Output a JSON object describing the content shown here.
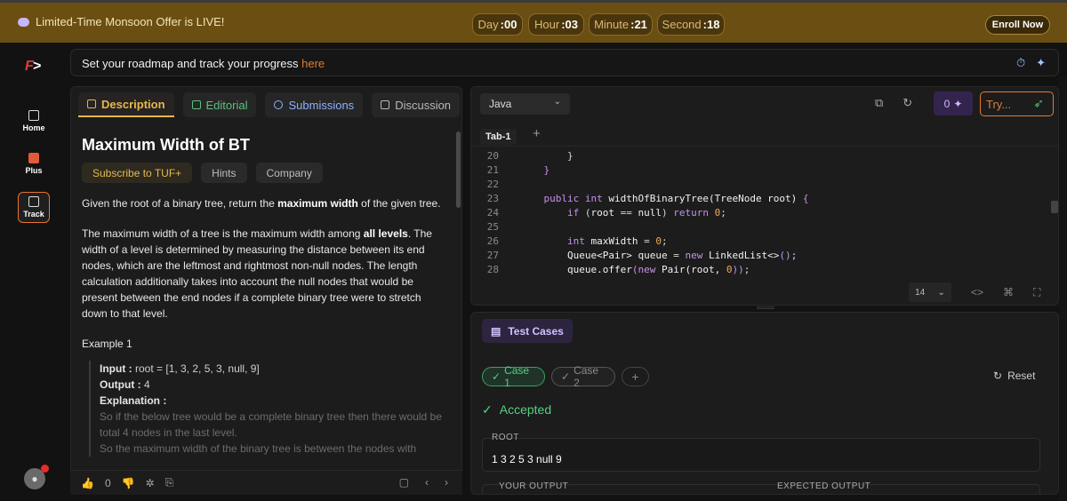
{
  "banner": {
    "offer": "Limited-Time Monsoon Offer is LIVE!",
    "timers": [
      {
        "label": "Day",
        "value": ":00"
      },
      {
        "label": "Hour",
        "value": ":03"
      },
      {
        "label": "Minute",
        "value": ":21"
      },
      {
        "label": "Second",
        "value": ":18"
      }
    ],
    "enroll": "Enroll Now"
  },
  "sidebar": {
    "logo": "F",
    "items": [
      {
        "label": "Home"
      },
      {
        "label": "Plus"
      },
      {
        "label": "Track"
      }
    ]
  },
  "roadmap": {
    "text": "Set your roadmap and track your progress",
    "link": "here"
  },
  "description": {
    "tabs": [
      {
        "label": "Description"
      },
      {
        "label": "Editorial"
      },
      {
        "label": "Submissions"
      },
      {
        "label": "Discussion"
      }
    ],
    "title": "Maximum Width of BT",
    "chips": [
      "Subscribe to TUF+",
      "Hints",
      "Company"
    ],
    "p1_a": "Given the root of a binary tree, return the",
    "p1_b": "maximum width",
    "p1_c": "of the given tree.",
    "p2_a": "The maximum width of a tree is the maximum width among",
    "p2_b": "all levels",
    "p2_c": ". The width of a level is determined by measuring the distance between its end nodes, which are the leftmost and rightmost non-null nodes. The length calculation additionally takes into account the null nodes that would be present between the end nodes if a complete binary tree were to stretch down to that level.",
    "example_title": "Example 1",
    "input_label": "Input :",
    "input_value": "root = [1, 3, 2, 5, 3, null, 9]",
    "output_label": "Output :",
    "output_value": "4",
    "explanation_label": "Explanation :",
    "explanation_1": "So if the below tree would be a complete binary tree then there would be total 4 nodes in the last level.",
    "explanation_2": "So the maximum width of the binary tree is between the nodes with",
    "likes": "0"
  },
  "editor": {
    "language": "Java",
    "ai_count": "0",
    "try_label": "Try...",
    "tab": "Tab-1",
    "font_size": "14",
    "lines": [
      20,
      21,
      22,
      23,
      24,
      25,
      26,
      27,
      28
    ]
  },
  "tests": {
    "title": "Test Cases",
    "cases": [
      "Case 1",
      "Case 2"
    ],
    "reset": "Reset",
    "status": "Accepted",
    "root_label": "ROOT",
    "root_value": "1 3 2 5 3 null 9",
    "your_output": "YOUR OUTPUT",
    "expected_output": "EXPECTED OUTPUT"
  },
  "colors": {
    "accent": "#e27b2f",
    "banner": "#6b4f12",
    "accepted": "#54d07f"
  }
}
